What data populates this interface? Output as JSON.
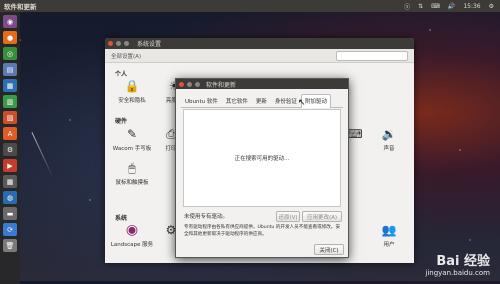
{
  "top_panel": {
    "title": "软件和更新",
    "time": "15:36"
  },
  "system_settings": {
    "title": "系统设置",
    "all_settings": "全部设置(A)",
    "sections": {
      "personal": "个人",
      "hardware": "硬件",
      "system": "系统"
    },
    "items": [
      {
        "label": "安全和隐私",
        "icon": "lock-icon"
      },
      {
        "label": "亮度和",
        "icon": "brightness-icon"
      },
      {
        "label": "Wacom 手写板",
        "icon": "pen-tablet-icon"
      },
      {
        "label": "打印",
        "icon": "printer-icon"
      },
      {
        "label": "鼠标和触摸板",
        "icon": "mouse-icon"
      },
      {
        "label": "声音",
        "icon": "speaker-icon"
      },
      {
        "label": "Landscape 服务",
        "icon": "landscape-icon"
      },
      {
        "label": "用户",
        "icon": "users-icon"
      },
      {
        "label": "用户",
        "icon": "users-icon"
      }
    ],
    "partial_label": "用户"
  },
  "dialog": {
    "title": "软件和更新",
    "tabs": [
      "Ubuntu 软件",
      "其它软件",
      "更新",
      "身份验证",
      "附加驱动"
    ],
    "active_tab": 4,
    "searching_text": "正在搜索可用的驱动...",
    "status_text": "未使用专有驱动。",
    "revert_button": "还原(V)",
    "apply_button": "应用更改(A)",
    "note": "专有驱动程序由各私有供应商提供，Ubuntu 的开发人员不能查看或修改。安全和其他更新取决于驱动程序的供应商。",
    "close_button": "关闭(C)"
  },
  "watermark": {
    "brand": "Bai 经验",
    "url": "jingyan.baidu.com"
  }
}
